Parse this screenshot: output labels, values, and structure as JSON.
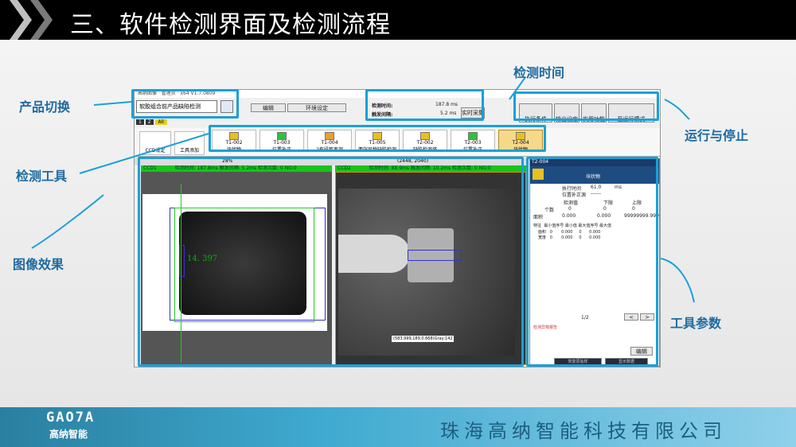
{
  "slide": {
    "title": "三、软件检测界面及检测流程",
    "company": "珠海高纳智能科技有限公司",
    "logo_text": "GAO7A",
    "logo_cn": "高纳智能"
  },
  "callouts": {
    "product_switch": "产品切换",
    "inspect_time": "检测时间",
    "inspect_tool": "检测工具",
    "run_stop": "运行与停止",
    "image_effect": "图像效果",
    "tool_params": "工具参数"
  },
  "app": {
    "title": "高纳图像 · 管理员 · x64 V1.7.0809",
    "product_value": "软胶组合前产品缺陷检测",
    "menu_edit": "编辑",
    "menu_env": "环境设定",
    "time_label": "检测时间:",
    "time_value": "187.8 ms",
    "trigger_label": "触发间隔:",
    "trigger_value": "5.2 ms",
    "realtime_btn": "实时采集",
    "run_buttons": [
      "执行条件",
      "输出设定",
      "实用功能",
      "至运行模式"
    ],
    "cam_tabs": [
      "1",
      "2",
      "All"
    ],
    "ccd_btn": "CCD设定",
    "tool_add_btn": "工具添加",
    "tools": [
      {
        "id": "T1-002",
        "name": "块状物"
      },
      {
        "id": "T1-003",
        "name": "位置补正"
      },
      {
        "id": "T1-004",
        "name": "2有段距离测"
      },
      {
        "id": "T1-005",
        "name": "两端异物缺陷检测"
      },
      {
        "id": "T2-002",
        "name": "缺陷检测坏"
      },
      {
        "id": "T2-003",
        "name": "位置补正"
      },
      {
        "id": "T2-004",
        "name": "块状物"
      }
    ],
    "zoom": "28%",
    "resolution": "(2448, 2040)",
    "ccd1": {
      "label": "CCD1",
      "status": "检测时间: 187.8ms  触发间隔: 5.2ms  检测次数: 0  NG:0"
    },
    "ccd2": {
      "label": "CCD2",
      "status": "检测时间: 88.9ms  触发间隔: 10.2ms  检测次数: 0  NG:0"
    },
    "measure": "14. 397",
    "pixel_info": "(583,999,189,0.668)Gray:142",
    "panel": {
      "tool_id": "T2-004",
      "header": "块状物",
      "tool_name": "块状物",
      "exec_time_label": "执行时间",
      "exec_time_value": "61.0",
      "exec_time_unit": "ms",
      "pos_label": "位置补正源",
      "pos_value": "------",
      "cols": [
        "检测值",
        "下限",
        "上限"
      ],
      "rows": [
        {
          "k": "个数",
          "v": "0",
          "lo": "0",
          "hi": "0"
        },
        {
          "k": "面积",
          "v": "0.000",
          "lo": "0.000",
          "hi": "99999999.999"
        }
      ],
      "stat_cols": [
        "特征",
        "最小值序号",
        "最小值",
        "最大值序号",
        "最大值"
      ],
      "stat_rows": [
        {
          "k": "面积",
          "a": "0",
          "b": "0.000",
          "c": "0",
          "d": "0.000"
        },
        {
          "k": "宽度",
          "a": "0",
          "b": "0.000",
          "c": "0",
          "d": "0.000"
        }
      ],
      "page": "1/2",
      "prev": "<",
      "next": ">",
      "log": "检测异物报告",
      "edit_btn": "编辑",
      "bottom_btns": [
        "恢复原始样",
        "显示数据"
      ]
    }
  }
}
